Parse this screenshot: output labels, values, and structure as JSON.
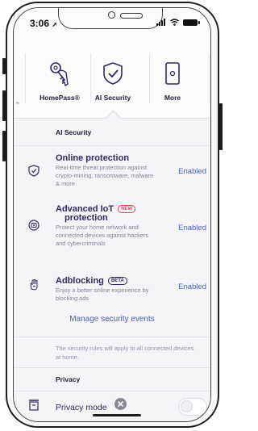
{
  "status_bar": {
    "time": "3:06"
  },
  "nav": {
    "items": [
      {
        "label": "HomePass®",
        "icon": "keys-icon"
      },
      {
        "label": "AI Security",
        "icon": "shield-check-icon",
        "selected": true
      },
      {
        "label": "More",
        "icon": "device-icon"
      }
    ]
  },
  "ai_security": {
    "section_title": "AI Security",
    "rows": [
      {
        "title": "Online protection",
        "badge": "",
        "desc": "Real-time threat protection against crypto-mining, ransomware, malware & more",
        "status": "Enabled",
        "icon": "shield-check-icon"
      },
      {
        "title": "Advanced IoT",
        "title2": "protection",
        "badge": "NEW",
        "desc": "Protect your home network and connected devices against hackers and cybercriminals",
        "status": "Enabled",
        "icon": "iot-device-icon"
      },
      {
        "title": "Adblocking",
        "badge": "BETA",
        "desc": "Enjoy a better online experience by blocking ads",
        "status": "Enabled",
        "icon": "hand-block-icon"
      }
    ],
    "manage_link": "Manage security events",
    "note": "The security rules will apply to all connected devices at home."
  },
  "privacy": {
    "section_title": "Privacy",
    "mode_label": "Privacy mode",
    "mode_enabled": false
  },
  "colors": {
    "accent": "#4b62b8",
    "title": "#2f2a66",
    "new_badge": "#e0454c"
  }
}
